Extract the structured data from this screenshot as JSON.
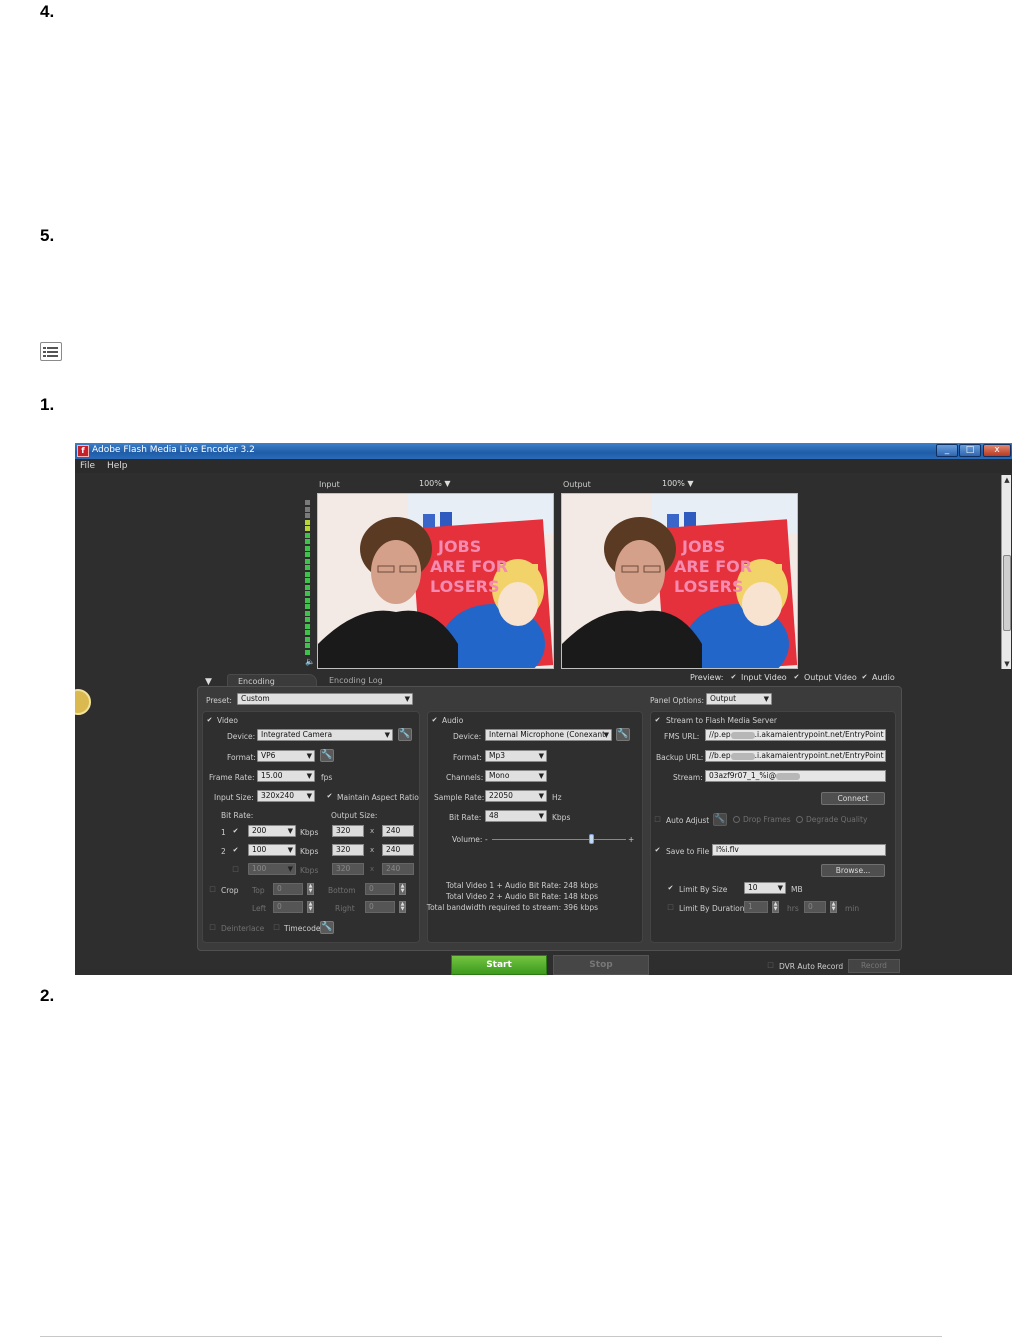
{
  "doc": {
    "steps_top": [
      "4.",
      "5."
    ],
    "steps_bottom": [
      "1.",
      "2."
    ]
  },
  "app": {
    "title": "Adobe Flash Media Live Encoder 3.2",
    "menu": [
      "File",
      "Help"
    ]
  },
  "preview": {
    "input_label": "Input",
    "input_zoom": "100% ▼",
    "output_label": "Output",
    "output_zoom": "100% ▼",
    "preview_label": "Preview:",
    "input_video": "Input Video",
    "output_video": "Output Video",
    "audio": "Audio"
  },
  "tabs": {
    "encoding_options": "Encoding Options",
    "encoding_log": "Encoding Log"
  },
  "preset": {
    "label": "Preset:",
    "value": "Custom"
  },
  "panel_options": {
    "label": "Panel Options:",
    "value": "Output"
  },
  "video": {
    "header": "Video",
    "device_label": "Device:",
    "device": "Integrated Camera",
    "format_label": "Format:",
    "format": "VP6",
    "frame_rate_label": "Frame Rate:",
    "frame_rate": "15.00",
    "fps": "fps",
    "input_size_label": "Input Size:",
    "input_size": "320x240",
    "maintain_aspect": "Maintain Aspect Ratio",
    "bit_rate_label": "Bit Rate:",
    "output_size_label": "Output Size:",
    "rows": [
      {
        "num": "1",
        "bitrate": "200",
        "unit": "Kbps",
        "w": "320",
        "h": "240"
      },
      {
        "num": "2",
        "bitrate": "100",
        "unit": "Kbps",
        "w": "320",
        "h": "240"
      },
      {
        "num": "",
        "bitrate": "100",
        "unit": "Kbps",
        "w": "320",
        "h": "240"
      }
    ],
    "x": "x",
    "crop": "Crop",
    "top": "Top",
    "bottom": "Bottom",
    "left": "Left",
    "right": "Right",
    "zero": "0",
    "deinterlace": "Deinterlace",
    "timecode": "Timecode"
  },
  "audio": {
    "header": "Audio",
    "device_label": "Device:",
    "device": "Internal Microphone (Conexant",
    "format_label": "Format:",
    "format": "Mp3",
    "channels_label": "Channels:",
    "channels": "Mono",
    "sample_rate_label": "Sample Rate:",
    "sample_rate": "22050",
    "hz": "Hz",
    "bit_rate_label": "Bit Rate:",
    "bit_rate": "48",
    "kbps": "Kbps",
    "volume_label": "Volume:",
    "minus": "-",
    "plus": "+",
    "volume_level": 0.74,
    "totals": [
      "Total Video 1 + Audio Bit Rate:  248 kbps",
      "Total Video 2 + Audio Bit Rate:  148 kbps",
      "Total bandwidth required to stream:  396 kbps"
    ]
  },
  "stream": {
    "header": "Stream to Flash Media Server",
    "fms_url_label": "FMS URL:",
    "fms_url_start": "//p.ep",
    "fms_url_end": ".i.akamaientrypoint.net/EntryPoint",
    "backup_url_label": "Backup URL:",
    "backup_url_start": "//b.ep",
    "backup_url_end": ".i.akamaientrypoint.net/EntryPoint",
    "stream_label": "Stream:",
    "stream_value": "03azf9r07_1_%i@",
    "connect": "Connect",
    "auto_adjust": "Auto Adjust",
    "drop_frames": "Drop Frames",
    "degrade_quality": "Degrade Quality",
    "save_to_file": "Save to File",
    "file_value": "l%i.flv",
    "browse": "Browse...",
    "limit_by_size": "Limit By Size",
    "size_value": "10",
    "mb": "MB",
    "limit_by_duration": "Limit By Duration",
    "hrs_value": "1",
    "hrs": "hrs",
    "min_value": "0",
    "min": "min"
  },
  "controls": {
    "start": "Start",
    "stop": "Stop",
    "dvr": "DVR Auto Record",
    "record": "Record"
  },
  "colors": {
    "start_green": "#4eaa2a",
    "title_blue": "#2a64b0",
    "meter_green": "#3fc24a"
  }
}
